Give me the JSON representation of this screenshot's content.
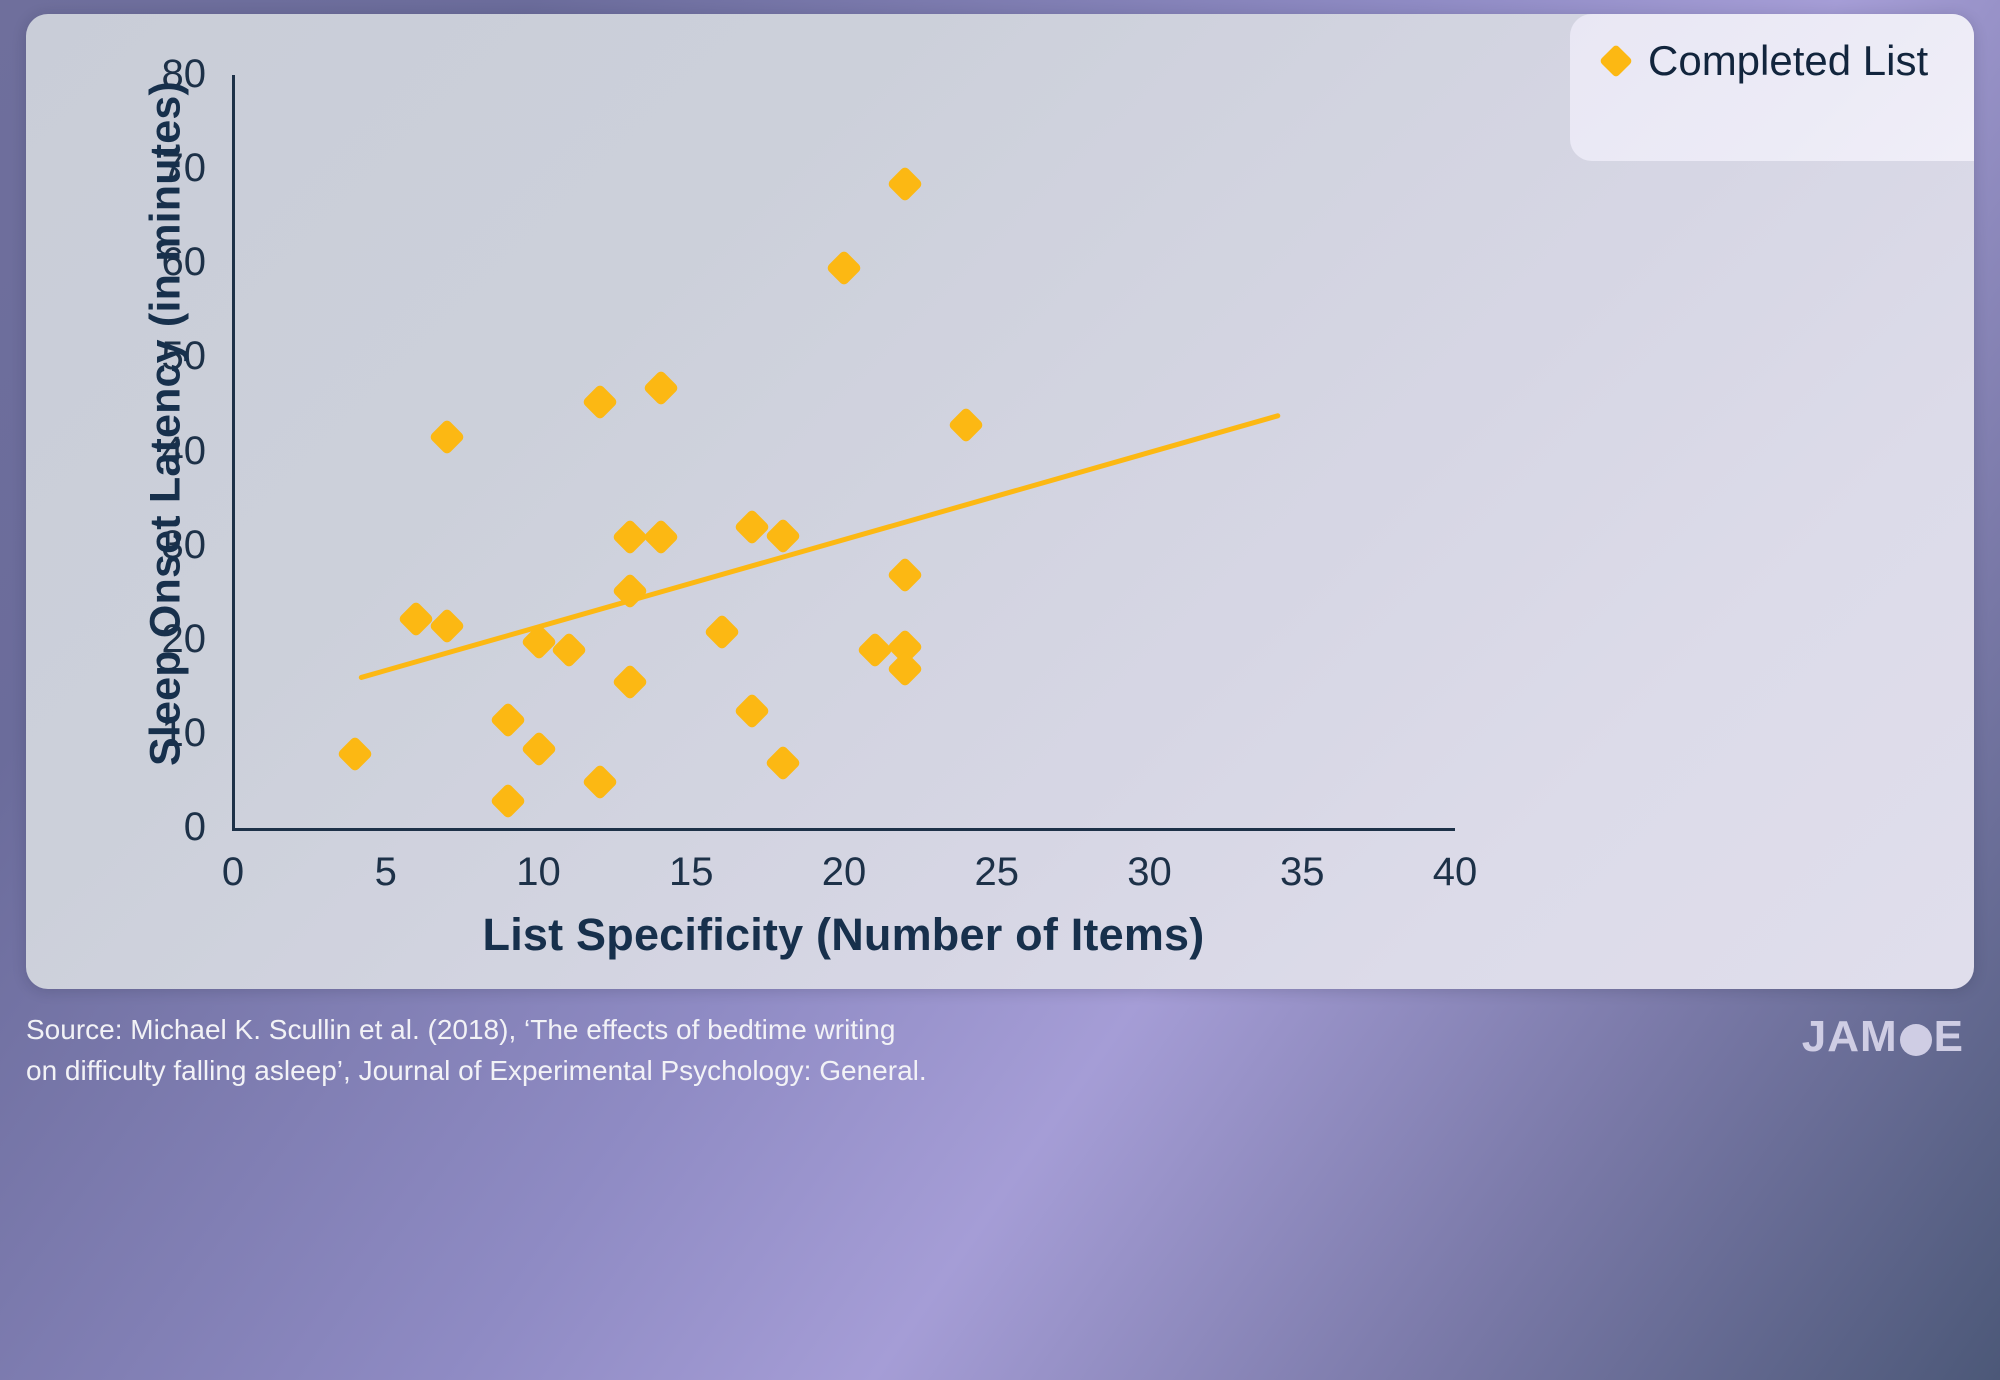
{
  "legend": {
    "items": [
      {
        "label": "Completed List",
        "color": "#fcb813",
        "marker": "diamond"
      }
    ]
  },
  "footer": {
    "source_line1": "Source: Michael K. Scullin et al. (2018), ‘The effects of bedtime writing",
    "source_line2": "on difficulty falling asleep’, Journal of Experimental Psychology: General.",
    "logo_before": "JAM",
    "logo_after": "E"
  },
  "colors": {
    "marker": "#fcb813",
    "trendline": "#fcb813",
    "axis": "#1d3148",
    "axis_text": "#1d3148",
    "title_text": "#17304c",
    "footer_text": "#f2f2f6"
  },
  "chart_data": {
    "type": "scatter",
    "title": "",
    "xlabel": "List Specificity (Number of Items)",
    "ylabel": "Sleep Onset Latency (in minutes)",
    "xlim": [
      0,
      40
    ],
    "ylim": [
      0,
      80
    ],
    "xticks": [
      0,
      5,
      10,
      15,
      20,
      25,
      30,
      35,
      40
    ],
    "yticks": [
      0,
      10,
      20,
      30,
      40,
      50,
      60,
      70,
      80
    ],
    "xtick_labels": [
      "0",
      "5",
      "10",
      "15",
      "20",
      "25",
      "30",
      "35",
      "40"
    ],
    "ytick_labels": [
      "0",
      "10",
      "20",
      "30",
      "40",
      "50",
      "60",
      "70",
      "80"
    ],
    "grid": false,
    "legend_position": "top-right",
    "series": [
      {
        "name": "Completed List",
        "marker": "diamond",
        "color": "#fcb813",
        "points": [
          [
            4,
            8
          ],
          [
            6,
            22.3
          ],
          [
            7,
            41.6
          ],
          [
            7,
            21.6
          ],
          [
            9,
            11.6
          ],
          [
            9,
            3
          ],
          [
            10,
            19.9
          ],
          [
            10,
            8.5
          ],
          [
            11,
            19
          ],
          [
            12,
            45.4
          ],
          [
            12,
            5
          ],
          [
            13,
            31
          ],
          [
            13,
            25.3
          ],
          [
            13,
            15.6
          ],
          [
            14,
            46.9
          ],
          [
            14,
            31
          ],
          [
            16,
            20.9
          ],
          [
            17,
            32.1
          ],
          [
            17,
            12.5
          ],
          [
            18,
            31.1
          ],
          [
            18,
            7
          ],
          [
            20,
            59.6
          ],
          [
            21,
            19
          ],
          [
            22,
            68.5
          ],
          [
            22,
            27
          ],
          [
            22,
            19.3
          ],
          [
            22,
            17
          ],
          [
            24,
            42.9
          ]
        ]
      }
    ],
    "trendline": {
      "name": "linear fit",
      "color": "#fcb813",
      "x_start": 4.2,
      "y_start": 16.1,
      "x_end": 34.2,
      "y_end": 43.9
    }
  }
}
